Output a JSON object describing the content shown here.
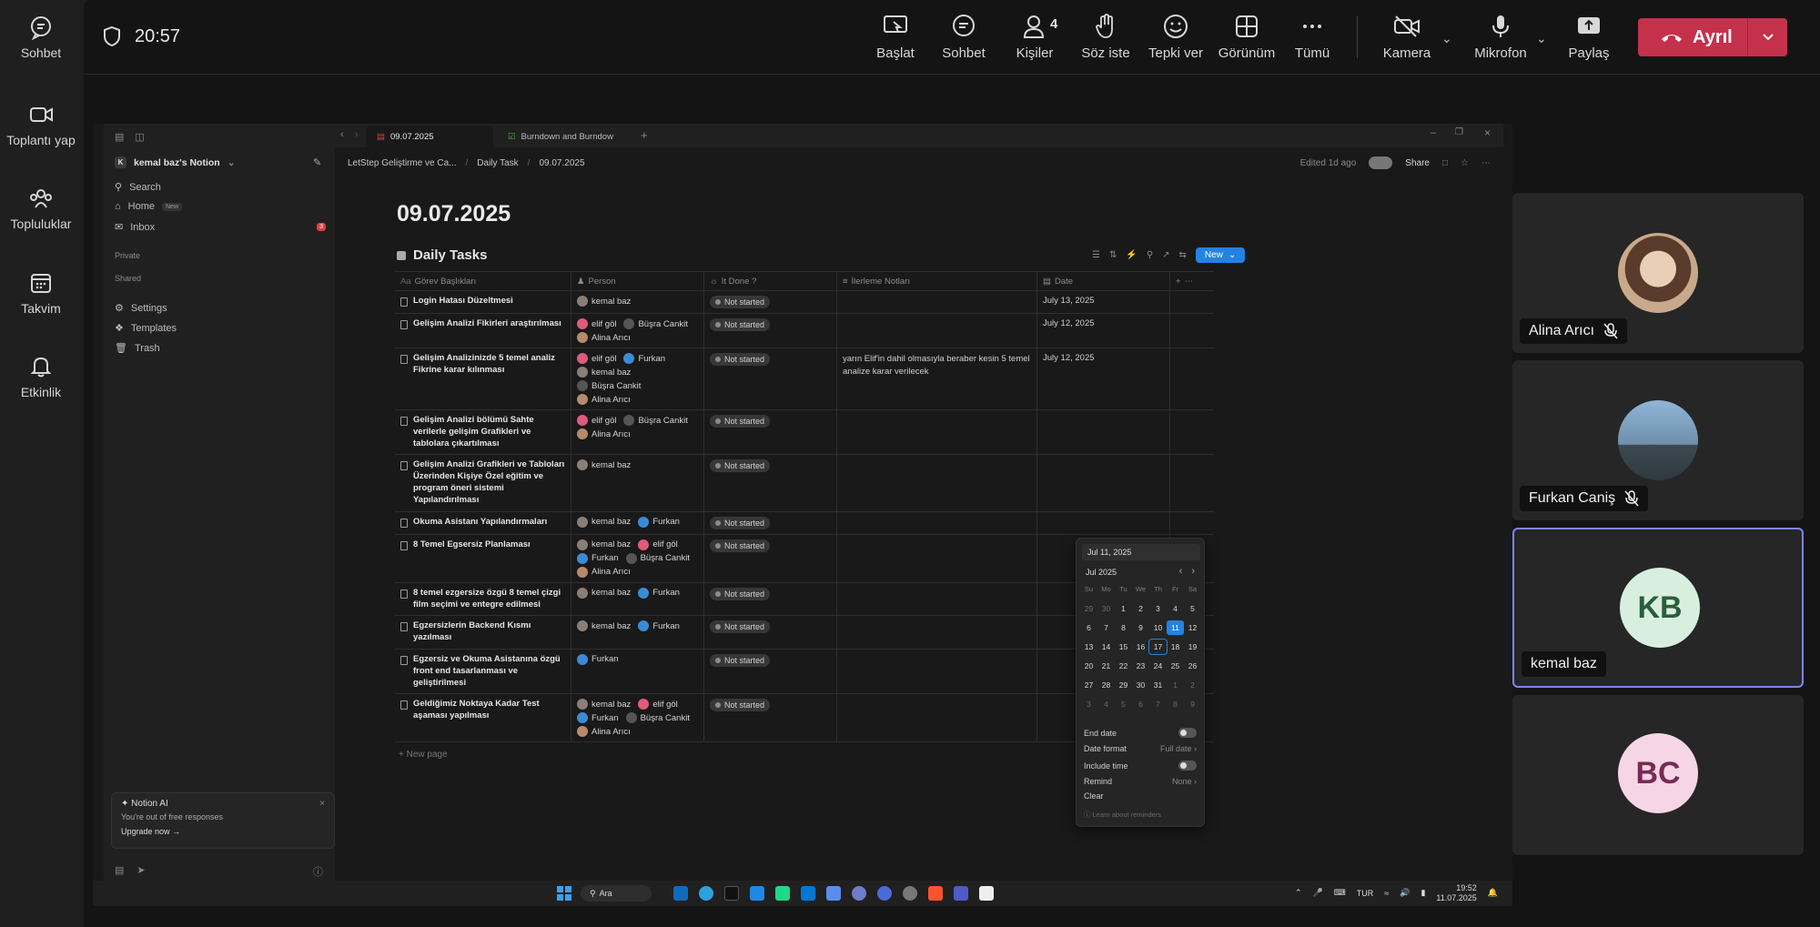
{
  "rail": [
    {
      "label": "Sohbet",
      "icon": "chat-icon"
    },
    {
      "label": "Toplantı yap",
      "icon": "video-icon"
    },
    {
      "label": "Topluluklar",
      "icon": "communities-icon"
    },
    {
      "label": "Takvim",
      "icon": "calendar-icon"
    },
    {
      "label": "Etkinlik",
      "icon": "bell-icon"
    }
  ],
  "meeting": {
    "timer": "20:57",
    "toolbar": {
      "start": "Başlat",
      "chat": "Sohbet",
      "people": "Kişiler",
      "people_count": "4",
      "raise_hand": "Söz iste",
      "react": "Tepki ver",
      "view": "Görünüm",
      "more": "Tümü",
      "camera": "Kamera",
      "mic": "Mikrofon",
      "share": "Paylaş",
      "leave": "Ayrıl"
    },
    "leave_color": "#c4314b"
  },
  "participants": [
    {
      "name": "Alina Arıcı",
      "muted": true
    },
    {
      "name": "Furkan Caniş",
      "muted": true
    },
    {
      "name": "kemal baz",
      "initials": "KB",
      "speaking": true
    },
    {
      "initials": "BC"
    }
  ],
  "notion": {
    "workspace": "kemal baz's Notion",
    "sidebar": {
      "search": "Search",
      "home": "Home",
      "home_badge": "New",
      "inbox": "Inbox",
      "inbox_count": "3",
      "private": "Private",
      "shared": "Shared",
      "settings": "Settings",
      "templates": "Templates",
      "trash": "Trash"
    },
    "ai_card": {
      "title": "Notion AI",
      "subtitle": "You're out of free responses",
      "cta": "Upgrade now"
    },
    "tabs": [
      {
        "label": "09.07.2025",
        "active": true
      },
      {
        "label": "Burndown and Burndow"
      }
    ],
    "breadcrumb": [
      "LetStep Geliştirme ve Ca...",
      "Daily Task",
      "09.07.2025"
    ],
    "edited": "Edited 1d ago",
    "share": "Share",
    "page_title": "09.07.2025",
    "db_title": "Daily Tasks",
    "new_button": "New",
    "columns": [
      "Görev Başlıkları",
      "Person",
      "It Done ?",
      "İlerleme Notları",
      "Date"
    ],
    "rows": [
      {
        "task": "Login Hatası Düzeltmesi",
        "people": [
          "kemal baz"
        ],
        "status": "Not started",
        "note": "",
        "date": "July 13, 2025"
      },
      {
        "task": "Gelişim Analizi Fikirleri araştırılması",
        "people": [
          "elif göl",
          "Büşra Cankit",
          "Alina Arıcı"
        ],
        "status": "Not started",
        "note": "",
        "date": "July 12, 2025"
      },
      {
        "task": "Gelişim Analizinizde 5 temel analiz Fikrine karar kılınması",
        "people": [
          "elif göl",
          "Furkan",
          "kemal baz",
          "Büşra Cankit",
          "Alina Arıcı"
        ],
        "status": "Not started",
        "note": "yarın Elif'in dahil olmasıyla beraber kesin 5 temel analize karar verilecek",
        "date": "July 12, 2025"
      },
      {
        "task": "Gelişim Analizi bölümü Sahte verilerle gelişim Grafikleri ve tablolara çıkartılması",
        "people": [
          "elif göl",
          "Büşra Cankit",
          "Alina Arıcı"
        ],
        "status": "Not started",
        "note": "",
        "date": ""
      },
      {
        "task": "Gelişim Analizi Grafikleri ve Tabloları Üzerinden Kişiye Özel eğitim ve program öneri sistemi Yapılandırılması",
        "people": [
          "kemal baz"
        ],
        "status": "Not started",
        "note": "",
        "date": ""
      },
      {
        "task": "Okuma Asistanı Yapılandırmaları",
        "people": [
          "kemal baz",
          "Furkan"
        ],
        "status": "Not started",
        "note": "",
        "date": ""
      },
      {
        "task": "8 Temel Egsersiz Planlaması",
        "people": [
          "kemal baz",
          "elif göl",
          "Furkan",
          "Büşra Cankit",
          "Alina Arıcı"
        ],
        "status": "Not started",
        "note": "",
        "date": ""
      },
      {
        "task": "8 temel ezgersize özgü 8 temel çizgi film seçimi ve entegre edilmesi",
        "people": [
          "kemal baz",
          "Furkan"
        ],
        "status": "Not started",
        "note": "",
        "date": ""
      },
      {
        "task": "Egzersizlerin Backend Kısmı yazılması",
        "people": [
          "kemal baz",
          "Furkan"
        ],
        "status": "Not started",
        "note": "",
        "date": ""
      },
      {
        "task": "Egzersiz ve Okuma Asistanına özgü front end tasarlanması ve geliştirilmesi",
        "people": [
          "Furkan"
        ],
        "status": "Not started",
        "note": "",
        "date": ""
      },
      {
        "task": "Geldiğimiz Noktaya Kadar Test aşaması yapılması",
        "people": [
          "kemal baz",
          "elif göl",
          "Furkan",
          "Büşra Cankit",
          "Alina Arıcı"
        ],
        "status": "Not started",
        "note": "",
        "date": ""
      }
    ],
    "new_page": "+ New page",
    "date_picker": {
      "input": "Jul 11, 2025",
      "month": "Jul 2025",
      "weekdays": [
        "Su",
        "Mo",
        "Tu",
        "We",
        "Th",
        "Fr",
        "Sa"
      ],
      "days": [
        [
          "29",
          "30",
          "1",
          "2",
          "3",
          "4",
          "5"
        ],
        [
          "6",
          "7",
          "8",
          "9",
          "10",
          "11",
          "12"
        ],
        [
          "13",
          "14",
          "15",
          "16",
          "17",
          "18",
          "19"
        ],
        [
          "20",
          "21",
          "22",
          "23",
          "24",
          "25",
          "26"
        ],
        [
          "27",
          "28",
          "29",
          "30",
          "31",
          "1",
          "2"
        ],
        [
          "3",
          "4",
          "5",
          "6",
          "7",
          "8",
          "9"
        ]
      ],
      "selected": "11",
      "hovered": "17",
      "end_date": "End date",
      "date_format": "Date format",
      "date_format_value": "Full date",
      "include_time": "Include time",
      "remind": "Remind",
      "remind_value": "None",
      "clear": "Clear",
      "learn": "Learn about reminders"
    }
  },
  "taskbar": {
    "search": "Ara",
    "lang": "TUR",
    "time": "19:52",
    "date": "11.07.2025"
  }
}
